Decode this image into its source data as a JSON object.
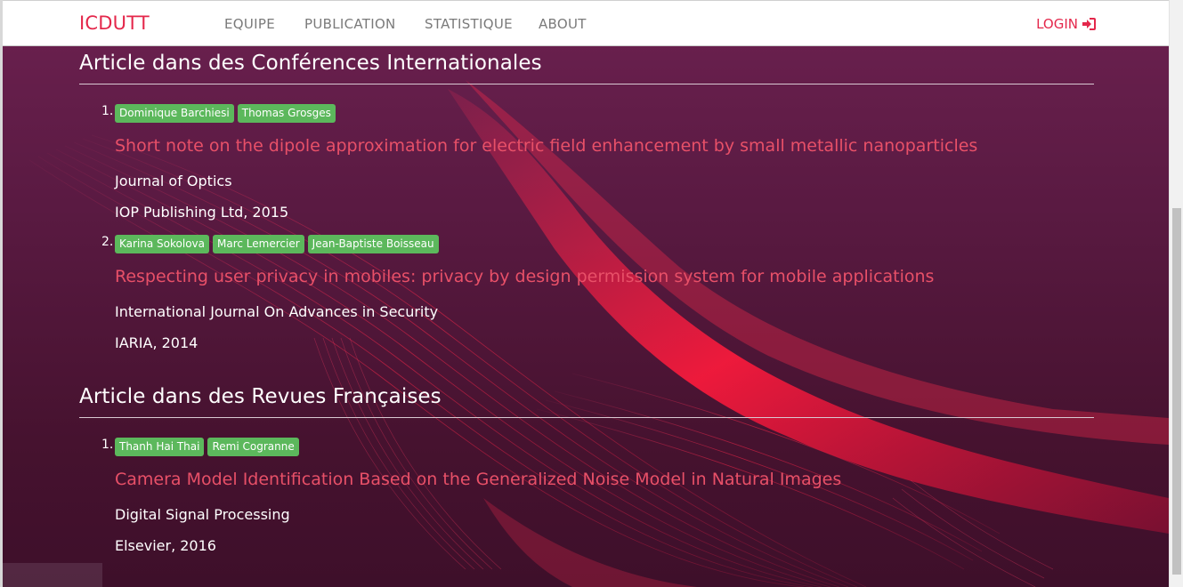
{
  "navbar": {
    "brand": "ICDUTT",
    "links": [
      "EQUIPE",
      "PUBLICATION",
      "STATISTIQUE",
      "ABOUT"
    ],
    "login_label": "LOGIN",
    "login_icon": "sign-in-icon"
  },
  "colors": {
    "accent": "#e4274b",
    "badge": "#5cb85c",
    "title_link": "#e85068",
    "background": "#5a1a42"
  },
  "sections": [
    {
      "title": "Article dans des Conférences Internationales",
      "items": [
        {
          "number": "1.",
          "authors": [
            "Dominique Barchiesi",
            "Thomas Grosges"
          ],
          "title": "Short note on the dipole approximation for electric field enhancement by small metallic nanoparticles",
          "journal": "Journal of Optics",
          "publisher": "IOP Publishing Ltd, 2015"
        },
        {
          "number": "2.",
          "authors": [
            "Karina Sokolova",
            "Marc Lemercier",
            "Jean-Baptiste Boisseau"
          ],
          "title": "Respecting user privacy in mobiles: privacy by design permission system for mobile applications",
          "journal": "International Journal On Advances in Security",
          "publisher": "IARIA, 2014"
        }
      ]
    },
    {
      "title": "Article dans des Revues Françaises",
      "items": [
        {
          "number": "1.",
          "authors": [
            "Thanh Hai Thai",
            "Remi Cogranne"
          ],
          "title": "Camera Model Identification Based on the Generalized Noise Model in Natural Images",
          "journal": "Digital Signal Processing",
          "publisher": "Elsevier, 2016"
        }
      ]
    }
  ]
}
